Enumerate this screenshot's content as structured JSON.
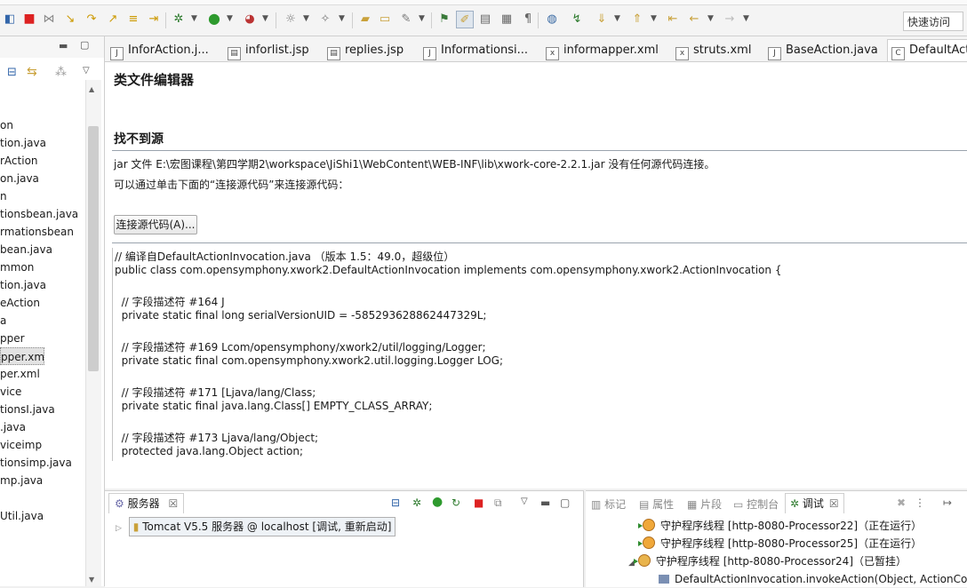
{
  "toolbar": {
    "quick_access": "快速访问"
  },
  "tabs": [
    {
      "label": "InforAction.j...",
      "icon": "java-file-icon"
    },
    {
      "label": "inforlist.jsp",
      "icon": "jsp-file-icon"
    },
    {
      "label": "replies.jsp",
      "icon": "jsp-file-icon"
    },
    {
      "label": "Informationsi...",
      "icon": "java-file-icon"
    },
    {
      "label": "informapper.xml",
      "icon": "xml-file-icon"
    },
    {
      "label": "struts.xml",
      "icon": "xml-file-icon"
    },
    {
      "label": "BaseAction.java",
      "icon": "java-file-icon"
    },
    {
      "label": "DefaultActio",
      "icon": "class-file-icon"
    }
  ],
  "tree": [
    "on",
    "tion.java",
    "rAction",
    "on.java",
    "n",
    "tionsbean.java",
    "rmationsbean",
    "bean.java",
    "mmon",
    "tion.java",
    "eAction",
    "a",
    "pper",
    "pper.xml",
    "per.xml",
    "vice",
    "tionsI.java",
    ".java",
    "viceimp",
    "tionsimp.java",
    "mp.java",
    "",
    "Util.java"
  ],
  "editor": {
    "title": "类文件编辑器",
    "not_found": "找不到源",
    "message": "jar 文件 E:\\宏图课程\\第四学期2\\workspace\\JiShi1\\WebContent\\WEB-INF\\lib\\xwork-core-2.2.1.jar 没有任何源代码连接。",
    "hint": "可以通过单击下面的“连接源代码”来连接源代码：",
    "attach_button": "连接源代码(A)...",
    "code": [
      "// 编译自DefaultActionInvocation.java （版本 1.5：49.0，超级位）",
      "public class com.opensymphony.xwork2.DefaultActionInvocation implements com.opensymphony.xwork2.ActionInvocation {",
      "",
      "  // 字段描述符 #164 J",
      "  private static final long serialVersionUID = -585293628862447329L;",
      "",
      "  // 字段描述符 #169 Lcom/opensymphony/xwork2/util/logging/Logger;",
      "  private static final com.opensymphony.xwork2.util.logging.Logger LOG;",
      "",
      "  // 字段描述符 #171 [Ljava/lang/Class;",
      "  private static final java.lang.Class[] EMPTY_CLASS_ARRAY;",
      "",
      "  // 字段描述符 #173 Ljava/lang/Object;",
      "  protected java.lang.Object action;"
    ]
  },
  "servers": {
    "tab_label": "服务器",
    "close": "☒",
    "row": "Tomcat V5.5 服务器 @ localhost  [调试, 重新启动]"
  },
  "debug": {
    "tabs": [
      "标记",
      "属性",
      "片段",
      "控制台",
      "调试"
    ],
    "threads": [
      "守护程序线程 [http-8080-Processor22]（正在运行）",
      "守护程序线程 [http-8080-Processor25]（正在运行）",
      "守护程序线程 [http-8080-Processor24]（已暂挂）",
      "DefaultActionInvocation.invokeAction(Object, ActionConf"
    ],
    "close": "☒"
  }
}
